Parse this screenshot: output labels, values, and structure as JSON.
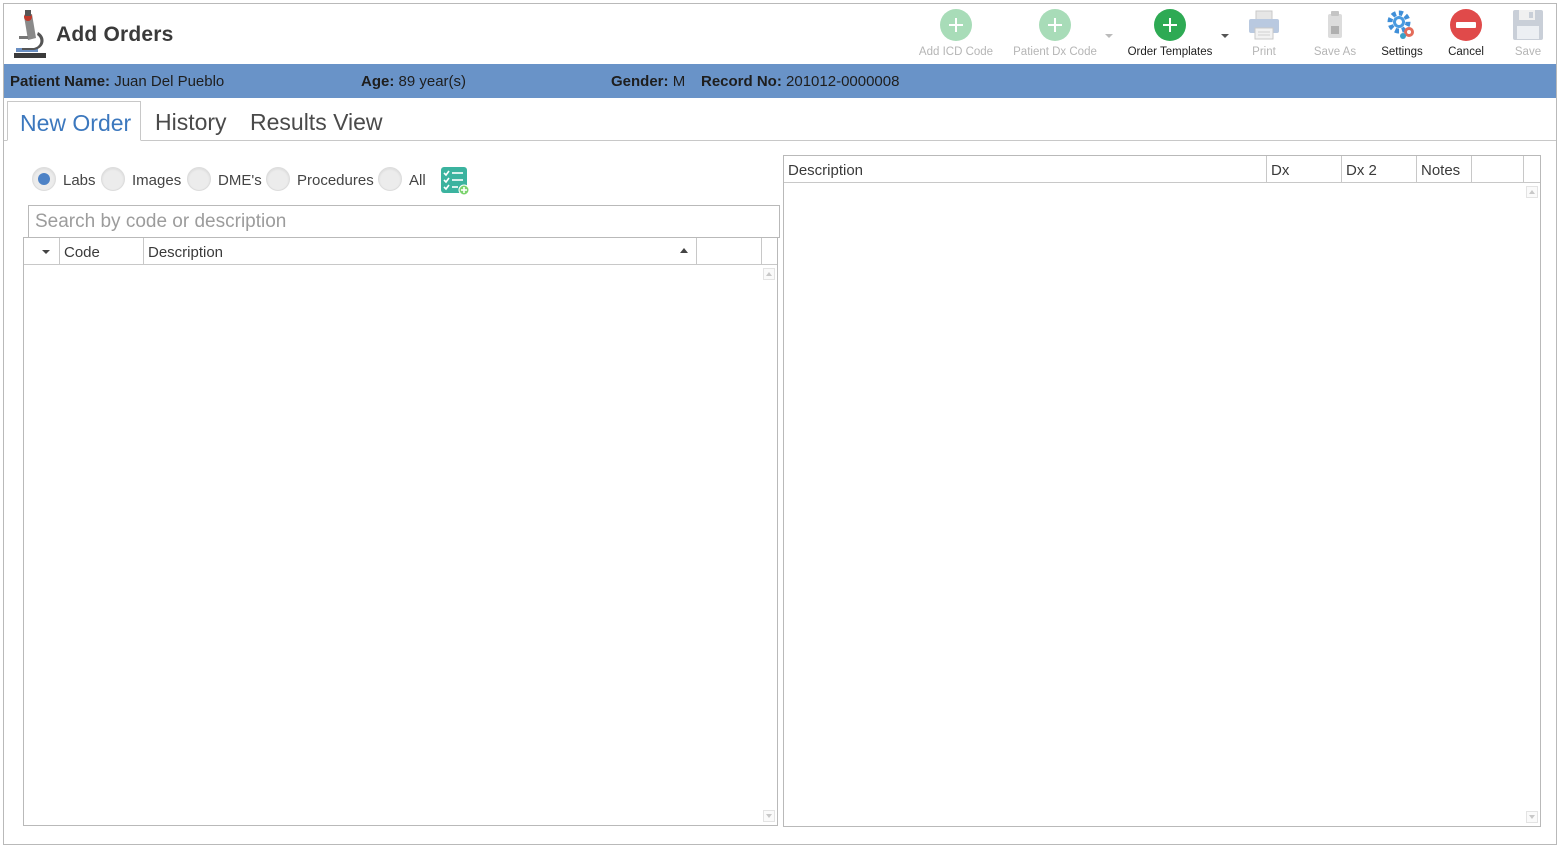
{
  "app": {
    "title": "Add Orders",
    "logo_icon": "microscope-icon"
  },
  "toolbar": {
    "add_icd_code": "Add ICD Code",
    "patient_dx_code": "Patient Dx Code",
    "order_templates": "Order Templates",
    "print": "Print",
    "save_as": "Save As",
    "settings": "Settings",
    "cancel": "Cancel",
    "save": "Save"
  },
  "patient": {
    "name_label": "Patient Name:",
    "name_value": "Juan Del Pueblo",
    "age_label": "Age:",
    "age_value": "89 year(s)",
    "gender_label": "Gender:",
    "gender_value": "M",
    "record_label": "Record No:",
    "record_value": "201012-0000008"
  },
  "tabs": [
    {
      "label": "New Order",
      "active": true
    },
    {
      "label": "History",
      "active": false
    },
    {
      "label": "Results View",
      "active": false
    }
  ],
  "filters": [
    {
      "label": "Labs",
      "selected": true
    },
    {
      "label": "Images",
      "selected": false
    },
    {
      "label": "DME's",
      "selected": false
    },
    {
      "label": "Procedures",
      "selected": false
    },
    {
      "label": "All",
      "selected": false
    }
  ],
  "search": {
    "placeholder": "Search by code or description",
    "value": ""
  },
  "code_grid": {
    "columns": [
      "Code",
      "Description"
    ],
    "sort": "Description ascending",
    "rows": []
  },
  "order_grid": {
    "columns": [
      "Description",
      "Dx",
      "Dx 2",
      "Notes"
    ],
    "rows": []
  },
  "colors": {
    "patient_bar": "#6993c8",
    "active_tab": "#3c78be",
    "radio_selected": "#4d82c6",
    "add_green": "#2eaa54",
    "cancel_red": "#e04a4a"
  }
}
